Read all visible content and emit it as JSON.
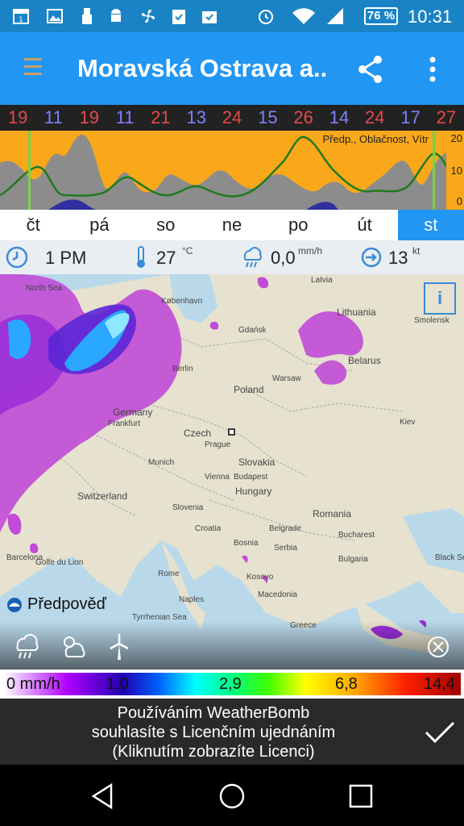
{
  "status_bar": {
    "battery": "76 %",
    "time": "10:31"
  },
  "app_bar": {
    "title": "Moravská Ostrava a..."
  },
  "temperatures": [
    {
      "value": "19",
      "color": "#e64a4a"
    },
    {
      "value": "11",
      "color": "#8080ff"
    },
    {
      "value": "19",
      "color": "#e64a4a"
    },
    {
      "value": "11",
      "color": "#8080ff"
    },
    {
      "value": "21",
      "color": "#e64a4a"
    },
    {
      "value": "13",
      "color": "#8080ff"
    },
    {
      "value": "24",
      "color": "#e64a4a"
    },
    {
      "value": "15",
      "color": "#8080ff"
    },
    {
      "value": "26",
      "color": "#e64a4a"
    },
    {
      "value": "14",
      "color": "#8080ff"
    },
    {
      "value": "24",
      "color": "#e64a4a"
    },
    {
      "value": "17",
      "color": "#8080ff"
    },
    {
      "value": "27",
      "color": "#e64a4a"
    }
  ],
  "graph": {
    "legend": "Předp., Oblačnost, Vítr",
    "axis_top": "20",
    "axis_mid": "10",
    "axis_bottom": "0"
  },
  "days": [
    {
      "label": "čt",
      "active": false
    },
    {
      "label": "pá",
      "active": false
    },
    {
      "label": "so",
      "active": false
    },
    {
      "label": "ne",
      "active": false
    },
    {
      "label": "po",
      "active": false
    },
    {
      "label": "út",
      "active": false
    },
    {
      "label": "st",
      "active": true
    }
  ],
  "info_row": {
    "time": "1 PM",
    "temperature": "27",
    "temperature_unit": "°C",
    "precipitation": "0,0",
    "precipitation_unit": "mm/h",
    "wind": "13",
    "wind_unit": "kt"
  },
  "map": {
    "forecast_label": "Předpověď",
    "info_symbol": "i",
    "labels": [
      {
        "text": "North Sea",
        "big": false
      },
      {
        "text": "København",
        "big": false
      },
      {
        "text": "Latvia",
        "big": false
      },
      {
        "text": "Lithuania",
        "big": true
      },
      {
        "text": "Smolensk",
        "big": false
      },
      {
        "text": "Gdańsk",
        "big": false
      },
      {
        "text": "Berlin",
        "big": false
      },
      {
        "text": "Warsaw",
        "big": false
      },
      {
        "text": "Poland",
        "big": true
      },
      {
        "text": "Belarus",
        "big": true
      },
      {
        "text": "Germany",
        "big": true
      },
      {
        "text": "Frankfurt",
        "big": false
      },
      {
        "text": "Czech",
        "big": true
      },
      {
        "text": "Prague",
        "big": false
      },
      {
        "text": "Kiev",
        "big": false
      },
      {
        "text": "Slovakia",
        "big": true
      },
      {
        "text": "Munich",
        "big": false
      },
      {
        "text": "Vienna",
        "big": false
      },
      {
        "text": "Budapest",
        "big": false
      },
      {
        "text": "Hungary",
        "big": true
      },
      {
        "text": "Switzerland",
        "big": true
      },
      {
        "text": "Slovenia",
        "big": false
      },
      {
        "text": "Croatia",
        "big": false
      },
      {
        "text": "Romania",
        "big": true
      },
      {
        "text": "Bosnia",
        "big": false
      },
      {
        "text": "Belgrade",
        "big": false
      },
      {
        "text": "Bucharest",
        "big": false
      },
      {
        "text": "Serbia",
        "big": false
      },
      {
        "text": "Bulgaria",
        "big": false
      },
      {
        "text": "Black Sea",
        "big": false
      },
      {
        "text": "Barcelona",
        "big": false
      },
      {
        "text": "Golfe du Lion",
        "big": false
      },
      {
        "text": "Rome",
        "big": false
      },
      {
        "text": "Naples",
        "big": false
      },
      {
        "text": "Kosovo",
        "big": false
      },
      {
        "text": "Macedonia",
        "big": false
      },
      {
        "text": "Tyrrhenian Sea",
        "big": false
      },
      {
        "text": "Greece",
        "big": false
      }
    ]
  },
  "color_scale": {
    "stops": [
      "0 mm/h",
      "1,0",
      "2,9",
      "6,8",
      "14,4"
    ]
  },
  "license": {
    "line1": "Používáním WeatherBomb",
    "line2": "souhlasíte s Licenčním ujednáním",
    "line3": "(Kliknutím zobrazíte Licenci)"
  },
  "colors": {
    "status_bar": "#1a83c5",
    "app_bar": "#2196f3",
    "graph_fill": "#f9a81a",
    "active_day": "#2196f3"
  },
  "icons": [
    "calendar-icon",
    "image-icon",
    "usb-icon",
    "android-icon",
    "fan-icon",
    "clipboard-check-icon",
    "briefcase-check-icon",
    "alarm-icon",
    "wifi-icon",
    "signal-icon",
    "share-icon",
    "more-vert-icon",
    "clock-icon",
    "thermometer-icon",
    "rain-icon",
    "wind-icon",
    "radar-rain-icon",
    "cloud-sun-icon",
    "wind-turbine-icon",
    "satellite-icon",
    "check-icon",
    "nav-back-icon",
    "nav-home-icon",
    "nav-recents-icon"
  ]
}
